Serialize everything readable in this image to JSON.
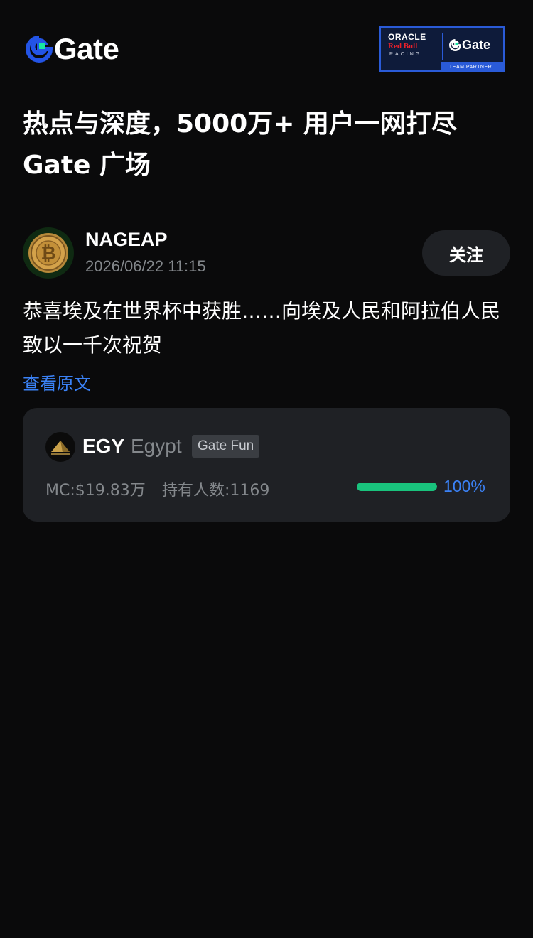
{
  "header": {
    "logo_text": "Gate",
    "partner_badge": {
      "line1": "ORACLE",
      "line2": "Red Bull",
      "line3": "RACING",
      "gate_text": "Gate",
      "caption": "TEAM PARTNER"
    }
  },
  "hero": {
    "title": "热点与深度，5000万+ 用户一网打尽 Gate 广场"
  },
  "post": {
    "author": "NAGEAP",
    "time": "2026/06/22 11:15",
    "follow_label": "关注",
    "body": "恭喜埃及在世界杯中获胜……向埃及人民和阿拉伯人民致以一千次祝贺",
    "view_original": "查看原文"
  },
  "token_card": {
    "symbol": "EGY",
    "name": "Egypt",
    "tag": "Gate Fun",
    "market_cap": "MC:$19.83万",
    "holders": "持有人数:1169",
    "progress_percent": 100,
    "progress_label": "100%"
  },
  "colors": {
    "background": "#0a0a0b",
    "card": "#1f2125",
    "link_blue": "#3b82f6",
    "progress_green": "#19c37d",
    "muted_text": "#84888c",
    "brand_blue": "#2354e6",
    "brand_green": "#17e6a1"
  }
}
